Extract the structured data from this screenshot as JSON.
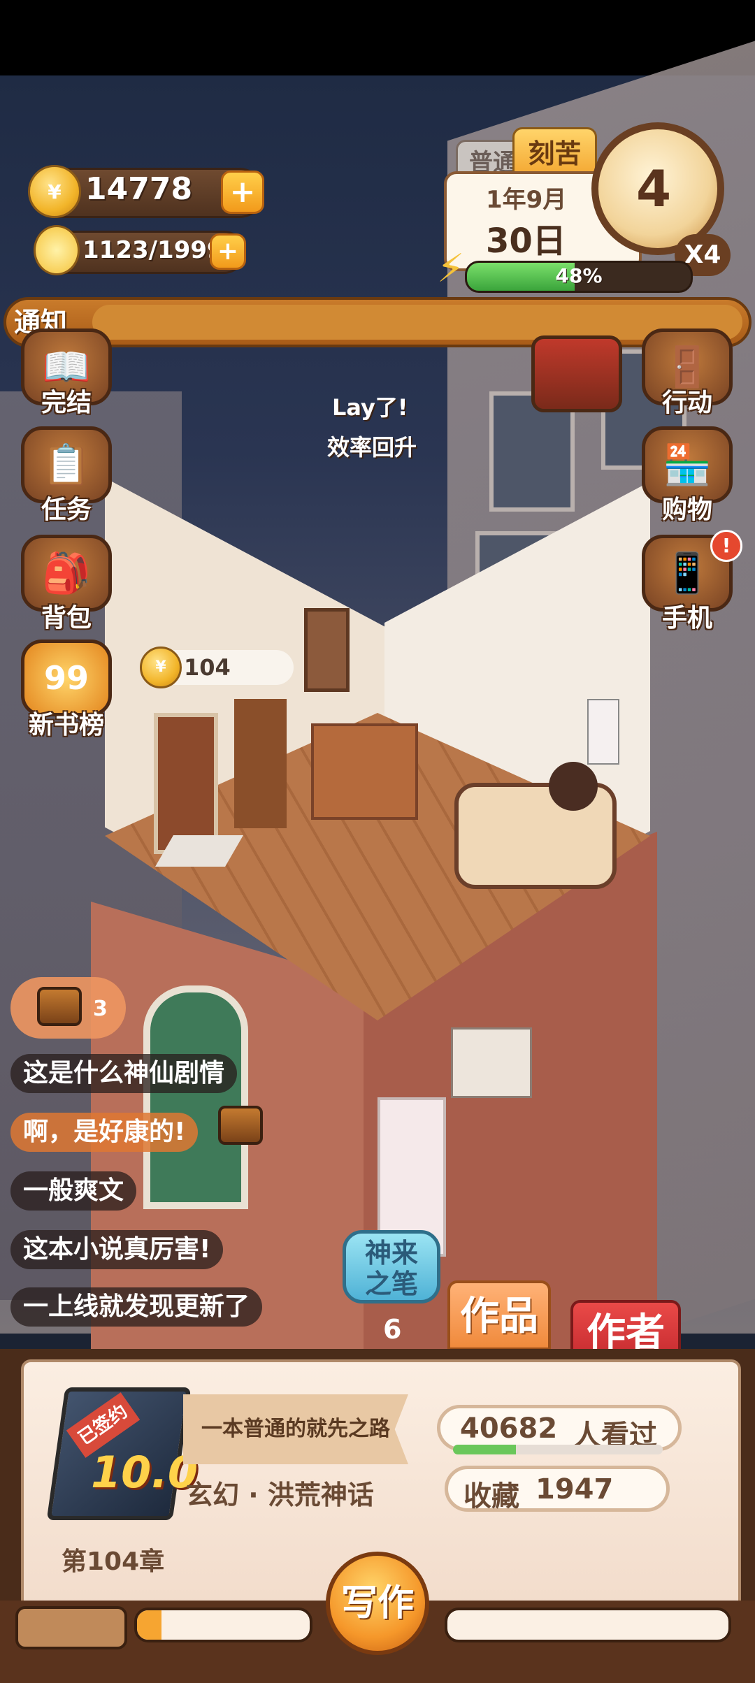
{
  "hud": {
    "coins": "14778",
    "bulbs": "1123/1999",
    "date_top": "1年9月",
    "date_day": "30日",
    "tab_normal": "普通",
    "tab_hard": "刻苦",
    "clock_number": "4",
    "speed": "X4",
    "energy_percent_label": "48%",
    "energy_fraction": 0.48,
    "notice_label": "通知"
  },
  "left_menu": [
    {
      "label": "完结",
      "icon": "finish-icon",
      "glyph": "📖"
    },
    {
      "label": "任务",
      "icon": "tasks-icon",
      "glyph": "📋"
    },
    {
      "label": "背包",
      "icon": "backpack-icon",
      "glyph": "🎒"
    },
    {
      "label": "新书榜",
      "icon": "newbook-rank-icon",
      "glyph": "99"
    }
  ],
  "right_menu": [
    {
      "label": "行动",
      "icon": "action-icon",
      "glyph": "🚪"
    },
    {
      "label": "购物",
      "icon": "shop-icon",
      "glyph": "🏪"
    },
    {
      "label": "手机",
      "icon": "phone-icon",
      "glyph": "📱"
    }
  ],
  "phone_badge": "!",
  "float_message": {
    "line1": "Lay了!",
    "line2": "效率回升"
  },
  "coin_bubble": "104",
  "treasure_count": "3",
  "chats": [
    {
      "text": "这是什么神仙剧情",
      "highlight": false
    },
    {
      "text": "啊，是好康的!",
      "highlight": true
    },
    {
      "text": "一般爽文",
      "highlight": false
    },
    {
      "text": "这本小说真厉害!",
      "highlight": false
    },
    {
      "text": "一上线就发现更新了",
      "highlight": false
    }
  ],
  "skill_button": {
    "line1": "神来",
    "line2": "之笔",
    "count": "6"
  },
  "tabs": {
    "works": "作品",
    "author": "作者"
  },
  "book": {
    "badge": "已签约",
    "score": "10.0",
    "title": "一本普通的就先之路",
    "genre": "玄幻 · 洪荒神话",
    "views_number": "40682",
    "views_suffix": "人看过",
    "views_bar_fraction": 0.3,
    "favorites_label": "收藏",
    "favorites": "1947",
    "chapter": "第104章"
  },
  "write_button": "写作",
  "bottom_progress_fraction": 0.14,
  "colors": {
    "accent_orange": "#f08a3c",
    "brown": "#4a2c1a",
    "green": "#3aa43b"
  }
}
